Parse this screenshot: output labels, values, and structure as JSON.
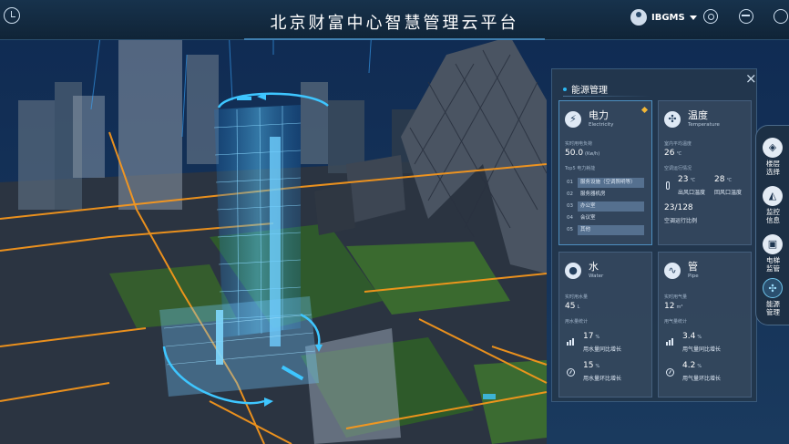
{
  "header": {
    "title": "北京财富中心智慧管理云平台",
    "user": "IBGMS",
    "icons": [
      "clock-icon",
      "settings-icon",
      "globe-icon",
      "power-icon"
    ]
  },
  "panel": {
    "title": "能源管理",
    "close_label": "×",
    "electricity": {
      "name": "电力",
      "sub": "Electricity",
      "load_label": "实时用电负荷",
      "load_value": "50.0",
      "load_unit": "(Kw/h)",
      "top_label": "Top5 电力耗能",
      "top5": [
        {
          "rank": "01",
          "name": "服务设施（空调照明等）"
        },
        {
          "rank": "02",
          "name": "服务器机房"
        },
        {
          "rank": "03",
          "name": "办公室"
        },
        {
          "rank": "04",
          "name": "会议室"
        },
        {
          "rank": "05",
          "name": "其他"
        }
      ]
    },
    "temperature": {
      "name": "温度",
      "sub": "Temperature",
      "avg_label": "室内平均温度",
      "avg_value": "26",
      "avg_unit": "℃",
      "ac_label": "空调运行情况",
      "outlet_value": "23",
      "outlet_unit": "℃",
      "outlet_label": "出风口温度",
      "return_value": "28",
      "return_unit": "℃",
      "return_label": "回风口温度",
      "ratio_value": "23/128",
      "ratio_label": "空调运行比例"
    },
    "water": {
      "name": "水",
      "sub": "Water",
      "now_label": "实时用水量",
      "now_value": "45",
      "now_unit": "L",
      "stat_label": "用水量统计",
      "yoy_value": "17",
      "yoy_unit": "%",
      "yoy_label": "用水量同比增长",
      "mom_value": "15",
      "mom_unit": "%",
      "mom_label": "用水量环比增长"
    },
    "pipe": {
      "name": "管",
      "sub": "Pipe",
      "now_label": "实时用气量",
      "now_value": "12",
      "now_unit": "m³",
      "stat_label": "用气量统计",
      "yoy_value": "3.4",
      "yoy_unit": "%",
      "yoy_label": "用气量同比增长",
      "mom_value": "4.2",
      "mom_unit": "%",
      "mom_label": "用气量环比增长"
    }
  },
  "sidenav": {
    "items": [
      {
        "label": "楼层选择",
        "icon": "layers-icon"
      },
      {
        "label": "监控信息",
        "icon": "camera-icon"
      },
      {
        "label": "电梯监管",
        "icon": "elevator-icon"
      },
      {
        "label": "能源管理",
        "icon": "fan-icon",
        "active": true
      }
    ]
  },
  "colors": {
    "accent": "#2bb7f2",
    "panel": "#24374c",
    "highlight": "#f2b636",
    "road_glow": "#ff9a1a"
  }
}
